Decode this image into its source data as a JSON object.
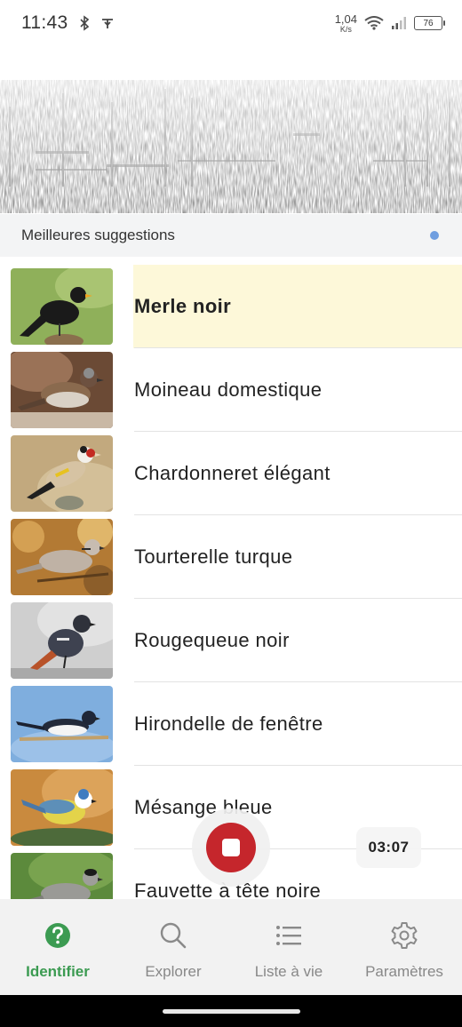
{
  "status_bar": {
    "time": "11:43",
    "net_speed_value": "1,04",
    "net_speed_unit": "K/s",
    "battery": "76",
    "icons": [
      "bluetooth-icon",
      "nfc-icon",
      "wifi-icon",
      "signal-icon",
      "battery-icon"
    ]
  },
  "suggestions": {
    "title": "Meilleures suggestions",
    "dot_color": "#6f9ee0"
  },
  "birds": [
    {
      "name": "Merle noir",
      "highlighted": true
    },
    {
      "name": "Moineau domestique",
      "highlighted": false
    },
    {
      "name": "Chardonneret élégant",
      "highlighted": false
    },
    {
      "name": "Tourterelle turque",
      "highlighted": false
    },
    {
      "name": "Rougequeue noir",
      "highlighted": false
    },
    {
      "name": "Hirondelle de fenêtre",
      "highlighted": false
    },
    {
      "name": "Mésange bleue",
      "highlighted": false
    },
    {
      "name": "Fauvette à tête noire",
      "highlighted": false
    }
  ],
  "recording": {
    "timer": "03:07",
    "button_color": "#c5262c"
  },
  "nav": {
    "items": [
      {
        "label": "Identifier",
        "icon": "question-circle-icon",
        "active": true
      },
      {
        "label": "Explorer",
        "icon": "search-icon",
        "active": false
      },
      {
        "label": "Liste à vie",
        "icon": "list-icon",
        "active": false
      },
      {
        "label": "Paramètres",
        "icon": "gear-icon",
        "active": false
      }
    ],
    "active_color": "#3c9b52"
  }
}
